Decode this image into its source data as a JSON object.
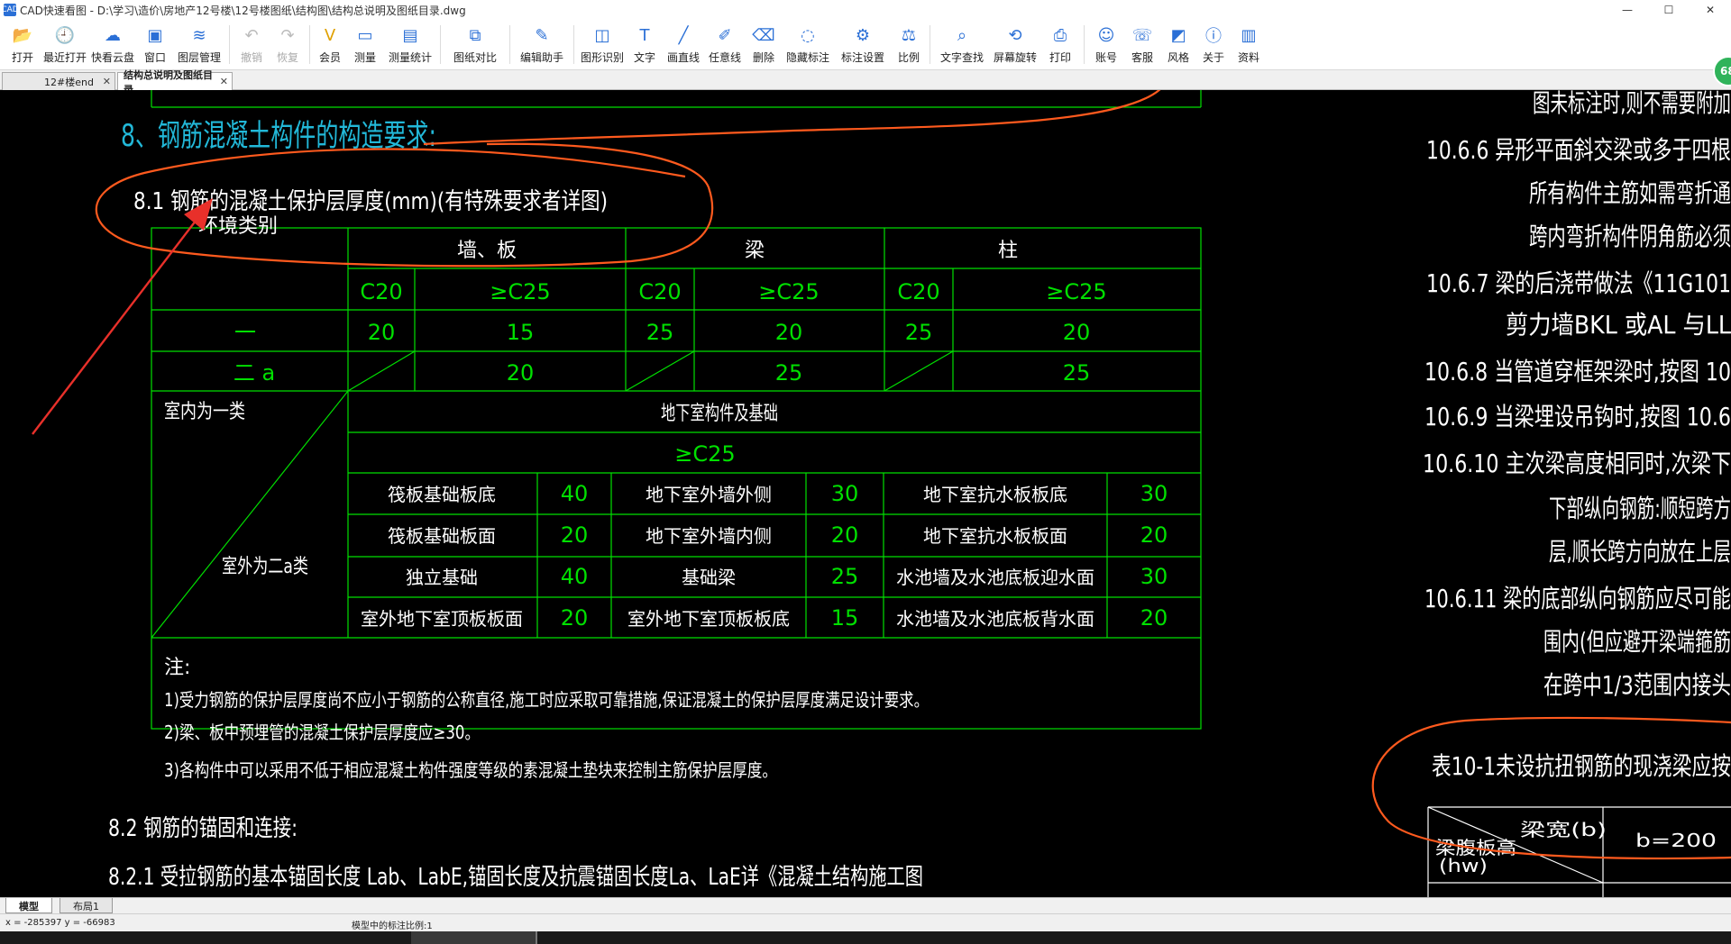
{
  "window": {
    "app_icon": "CAD",
    "title": "CAD快速看图 - D:\\学习\\造价\\房地产12号楼\\12号楼图纸\\结构图\\结构总说明及图纸目录.dwg",
    "controls": [
      "—",
      "☐",
      "✕"
    ]
  },
  "toolbar": [
    {
      "label": "打开",
      "icon": "folder-icon",
      "disabled": false
    },
    {
      "label": "最近打开",
      "icon": "recent-clock-icon",
      "disabled": false
    },
    {
      "label": "快看云盘",
      "icon": "cloud-icon",
      "disabled": false
    },
    {
      "label": "窗口",
      "icon": "window-icon",
      "disabled": false
    },
    {
      "label": "图层管理",
      "icon": "layers-icon",
      "disabled": false
    },
    {
      "label": "撤销",
      "icon": "undo-icon",
      "disabled": true
    },
    {
      "label": "恢复",
      "icon": "redo-icon",
      "disabled": true
    },
    {
      "label": "会员",
      "icon": "vip-icon",
      "disabled": false
    },
    {
      "label": "测量",
      "icon": "measure-icon",
      "disabled": false
    },
    {
      "label": "测量统计",
      "icon": "measure-stats-icon",
      "disabled": false
    },
    {
      "label": "图纸对比",
      "icon": "compare-icon",
      "disabled": false
    },
    {
      "label": "编辑助手",
      "icon": "edit-assistant-icon",
      "disabled": false
    },
    {
      "label": "图形识别",
      "icon": "shape-recognize-icon",
      "disabled": false
    },
    {
      "label": "文字",
      "icon": "text-icon",
      "disabled": false
    },
    {
      "label": "画直线",
      "icon": "line-icon",
      "disabled": false
    },
    {
      "label": "任意线",
      "icon": "freehand-icon",
      "disabled": false
    },
    {
      "label": "删除",
      "icon": "eraser-icon",
      "disabled": false
    },
    {
      "label": "隐藏标注",
      "icon": "hide-annotation-icon",
      "disabled": false
    },
    {
      "label": "标注设置",
      "icon": "annotation-settings-icon",
      "disabled": false
    },
    {
      "label": "比例",
      "icon": "scale-icon",
      "disabled": false
    },
    {
      "label": "文字查找",
      "icon": "text-search-icon",
      "disabled": false
    },
    {
      "label": "屏幕旋转",
      "icon": "rotate-screen-icon",
      "disabled": false
    },
    {
      "label": "打印",
      "icon": "print-icon",
      "disabled": false
    },
    {
      "label": "账号",
      "icon": "account-icon",
      "disabled": false
    },
    {
      "label": "客服",
      "icon": "headset-icon",
      "disabled": false
    },
    {
      "label": "风格",
      "icon": "style-icon",
      "disabled": false
    },
    {
      "label": "关于",
      "icon": "info-icon",
      "disabled": false
    },
    {
      "label": "资料",
      "icon": "docs-icon",
      "disabled": false
    }
  ],
  "tabs": [
    {
      "label": "12#楼end",
      "active": false
    },
    {
      "label": "结构总说明及图纸目录",
      "active": true
    }
  ],
  "drawing": {
    "heading8": "8、钢筋混凝土构件的构造要求:",
    "heading81": "8.1  钢筋的混凝土保护层厚度(mm)(有特殊要求者详图)",
    "table1": {
      "env_header": "环境类别",
      "groups": [
        "墙、板",
        "梁",
        "柱"
      ],
      "grades": [
        "C20",
        "≥C25",
        "C20",
        "≥C25",
        "C20",
        "≥C25"
      ],
      "row1_label": "一",
      "row1": [
        "20",
        "15",
        "25",
        "20",
        "25",
        "20"
      ],
      "row2_label": "二 a",
      "row2": [
        "20",
        "25",
        "25"
      ]
    },
    "table2": {
      "indoor": "室内为一类",
      "outdoor": "室外为二a类",
      "header": "地下室构件及基础",
      "grade": "≥C25",
      "rows": [
        [
          "筏板基础板底",
          "40",
          "地下室外墙外侧",
          "30",
          "地下室抗水板板底",
          "30"
        ],
        [
          "筏板基础板面",
          "20",
          "地下室外墙内侧",
          "20",
          "地下室抗水板板面",
          "20"
        ],
        [
          "独立基础",
          "40",
          "基础梁",
          "25",
          "水池墙及水池底板迎水面",
          "30"
        ],
        [
          "室外地下室顶板板面",
          "20",
          "室外地下室顶板板底",
          "15",
          "水池墙及水池底板背水面",
          "20"
        ]
      ]
    },
    "notes": [
      "注:",
      "1)受力钢筋的保护层厚度尚不应小于钢筋的公称直径,施工时应采取可靠措施,保证混凝土的保护层厚度满足设计要求。",
      "2)梁、板中预埋管的混凝土保护层厚度应≥30。",
      "3)各构件中可以采用不低于相应混凝土构件强度等级的素混凝土垫块来控制主筋保护层厚度。"
    ],
    "heading82": "8.2  钢筋的锚固和连接:",
    "heading821": "8.2.1  受拉钢筋的基本锚固长度 Lab、LabE,锚固长度及抗震锚固长度La、LaE详《混凝土结构施工图",
    "right_lines": [
      "图未标注时,则不需要附加",
      "10.6.6  异形平面斜交梁或多于四根",
      "所有构件主筋如需弯折通",
      "跨内弯折构件阴角筋必须",
      "10.6.7  梁的后浇带做法《11G101",
      "剪力墙BKL 或AL 与LL",
      "10.6.8  当管道穿框架梁时,按图 10",
      "10.6.9  当梁埋设吊钩时,按图 10.6",
      "10.6.10  主次梁高度相同时,次梁下",
      "下部纵向钢筋:顺短跨方",
      "层,顺长跨方向放在上层",
      "10.6.11  梁的底部纵向钢筋应尽可能",
      "围内(但应避开梁端箍筋",
      "在跨中1/3范围内接头",
      "表10-1未设抗扭钢筋的现浇梁应按",
      "梁宽(b)",
      "梁腹板高",
      "(hw)",
      "b=200"
    ]
  },
  "layout_tabs": [
    {
      "label": "模型",
      "active": true
    },
    {
      "label": "布局1",
      "active": false
    }
  ],
  "status": {
    "coords": "x = -285397  y = -66983",
    "scale": "模型中的标注比例:1"
  },
  "badge": "68",
  "colors": {
    "cad_green": "#00e000",
    "cad_white": "#ffffff",
    "heading_cyan": "#22b8d8",
    "markup_orange": "#ff5a1e",
    "arrow_red": "#e8302a"
  }
}
